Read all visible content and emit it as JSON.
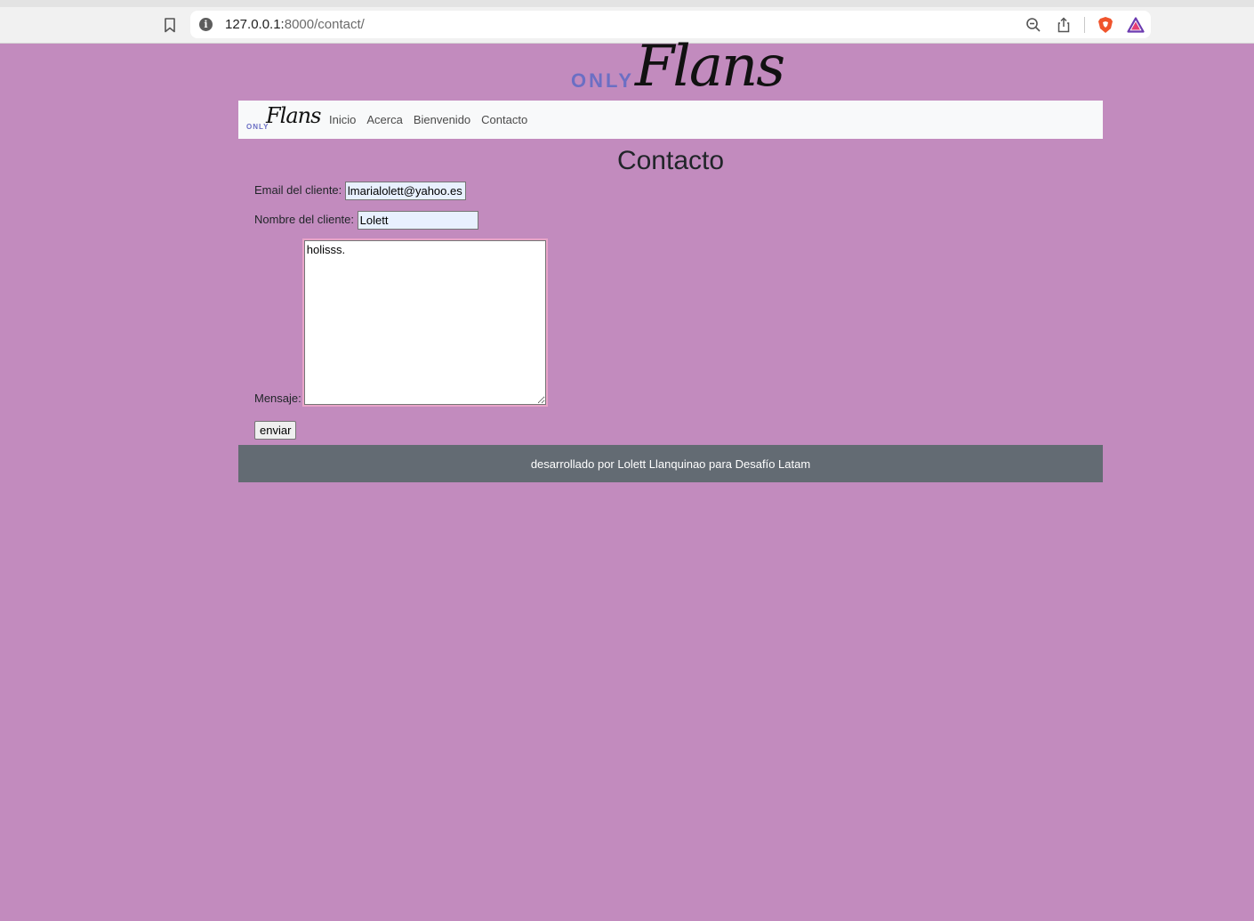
{
  "browser": {
    "url_host": "127.0.0.1:",
    "url_rest": "8000/contact/"
  },
  "brand": {
    "only": "ONLY",
    "flans": "Flans"
  },
  "nav": {
    "items": [
      {
        "label": "Inicio"
      },
      {
        "label": "Acerca"
      },
      {
        "label": "Bienvenido"
      },
      {
        "label": "Contacto"
      }
    ]
  },
  "page": {
    "title": "Contacto"
  },
  "form": {
    "email_label": "Email del cliente:",
    "email_value": "lmarialolett@yahoo.es",
    "name_label": "Nombre del cliente:",
    "name_value": "Lolett",
    "message_label": "Mensaje:",
    "message_value": "holisss.",
    "submit_label": "enviar"
  },
  "footer": {
    "text": "desarrollado por Lolett Llanquinao para Desafío Latam"
  },
  "colors": {
    "page_bg": "#c28bbe",
    "navbar_bg": "#f8f9fa",
    "footer_bg": "#636b73",
    "only_text": "#6b6fc4"
  }
}
